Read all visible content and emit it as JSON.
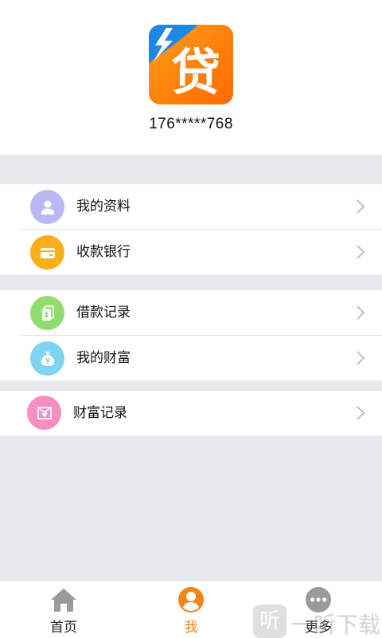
{
  "profile": {
    "logo_char": "贷",
    "phone": "176*****768"
  },
  "menu": {
    "group1": [
      {
        "label": "我的资料",
        "icon": "user-icon",
        "color": "#b9b8f2"
      },
      {
        "label": "收款银行",
        "icon": "card-icon",
        "color": "#f9ae1c"
      }
    ],
    "group2": [
      {
        "label": "借款记录",
        "icon": "document-icon",
        "color": "#91dc6f"
      },
      {
        "label": "我的财富",
        "icon": "money-bag-icon",
        "color": "#7fd4ef"
      }
    ],
    "group3": [
      {
        "label": "财富记录",
        "icon": "wallet-heart-icon",
        "color": "#f78ec2"
      }
    ]
  },
  "tabbar": {
    "home": "首页",
    "me": "我",
    "more": "更多",
    "active": "me",
    "active_color": "#f08519"
  },
  "watermark": {
    "glyph": "听",
    "text": "一听下载"
  }
}
